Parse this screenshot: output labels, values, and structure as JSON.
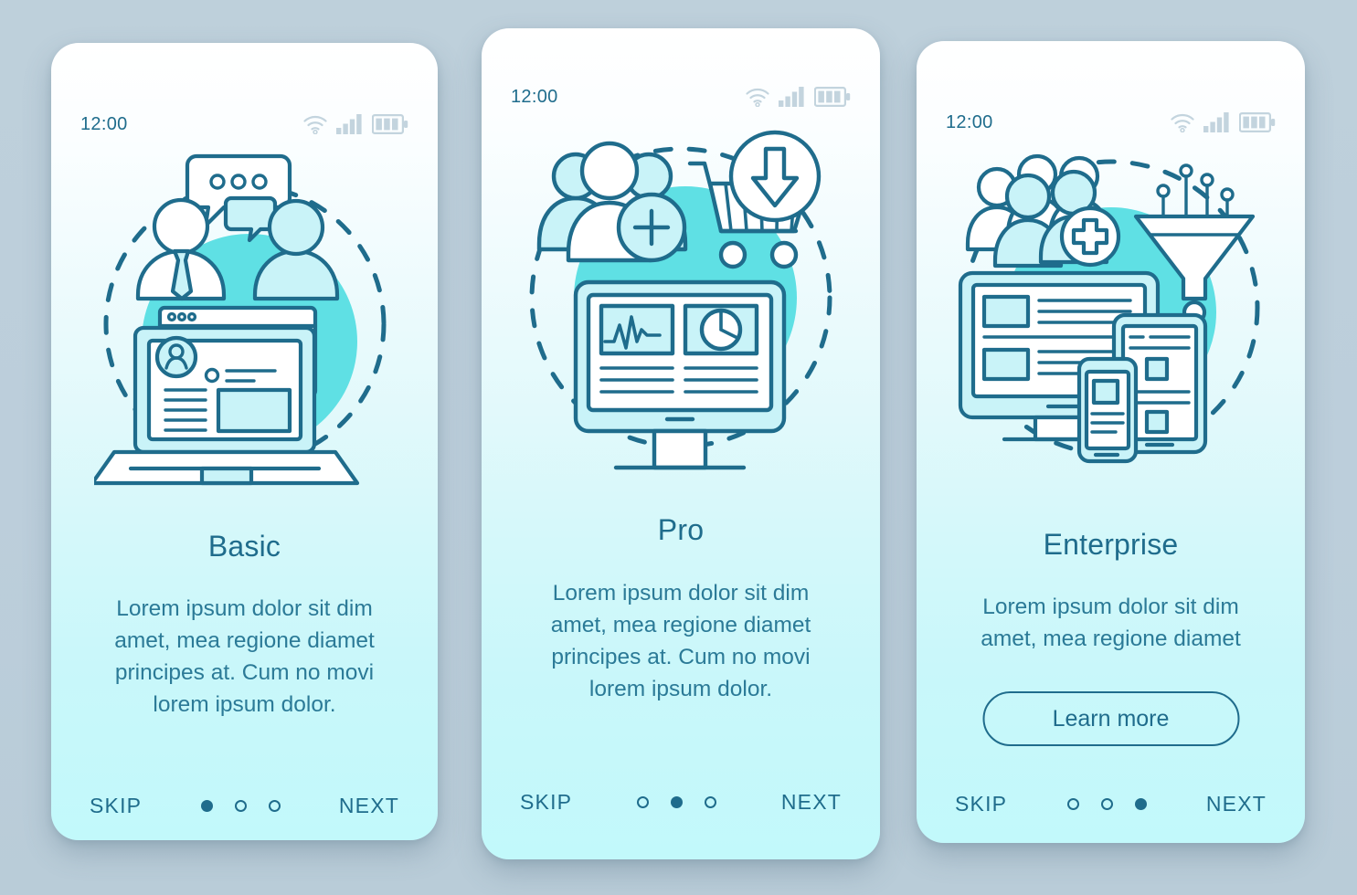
{
  "page": {
    "background_color": "#bccedb",
    "accent_color": "#1f6c8c",
    "teal_color": "#5fe0e4",
    "card_bottom_color": "#c2f9fb"
  },
  "status_bar": {
    "time": "12:00",
    "icons": [
      "wifi-icon",
      "signal-icon",
      "battery-icon"
    ]
  },
  "screens": [
    {
      "id": "basic",
      "illustration": "team-chat-laptop-illustration",
      "title": "Basic",
      "description": "Lorem ipsum dolor sit dim amet, mea regione diamet principes at. Cum no movi lorem ipsum dolor.",
      "skip_label": "SKIP",
      "next_label": "NEXT",
      "dots": [
        true,
        false,
        false
      ],
      "cta": null
    },
    {
      "id": "pro",
      "illustration": "users-cart-analytics-illustration",
      "title": "Pro",
      "description": "Lorem ipsum dolor sit dim amet, mea regione diamet principes at. Cum no movi lorem ipsum dolor.",
      "skip_label": "SKIP",
      "next_label": "NEXT",
      "dots": [
        false,
        true,
        false
      ],
      "cta": null
    },
    {
      "id": "enterprise",
      "illustration": "users-funnel-devices-illustration",
      "title": "Enterprise",
      "description": "Lorem ipsum dolor sit dim amet, mea regione diamet",
      "skip_label": "SKIP",
      "next_label": "NEXT",
      "dots": [
        false,
        false,
        true
      ],
      "cta": "Learn more"
    }
  ]
}
